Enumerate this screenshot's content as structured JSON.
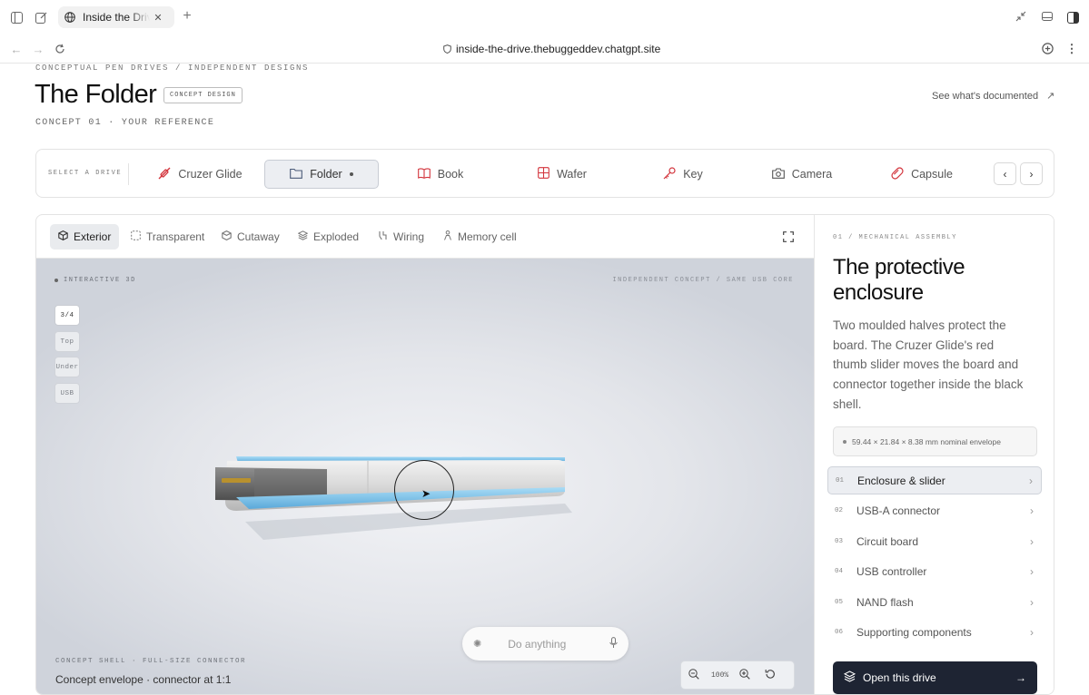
{
  "browser": {
    "tab_title": "Inside the Drive",
    "url": "inside-the-drive.thebuggeddev.chatgpt.site"
  },
  "header": {
    "breadcrumb": "CONCEPTUAL PEN DRIVES / INDEPENDENT DESIGNS",
    "title": "The Folder",
    "badge": "CONCEPT DESIGN",
    "subtitle": "CONCEPT 01 · YOUR REFERENCE",
    "docs_link": "See what's documented"
  },
  "selector": {
    "label": "SELECT A DRIVE",
    "drives": [
      {
        "label": "Cruzer Glide",
        "icon": "slider-icon"
      },
      {
        "label": "Folder",
        "icon": "folder-icon",
        "active": true
      },
      {
        "label": "Book",
        "icon": "book-icon"
      },
      {
        "label": "Wafer",
        "icon": "grid-icon"
      },
      {
        "label": "Key",
        "icon": "key-icon"
      },
      {
        "label": "Camera",
        "icon": "camera-icon"
      },
      {
        "label": "Capsule",
        "icon": "capsule-icon"
      }
    ]
  },
  "viewer": {
    "tabs": [
      {
        "label": "Exterior",
        "active": true
      },
      {
        "label": "Transparent"
      },
      {
        "label": "Cutaway"
      },
      {
        "label": "Exploded"
      },
      {
        "label": "Wiring"
      },
      {
        "label": "Memory cell"
      }
    ],
    "stage_label": "INTERACTIVE 3D",
    "stage_note": "INDEPENDENT CONCEPT / SAME USB CORE",
    "views": [
      "3/4",
      "Top",
      "Under",
      "USB"
    ],
    "prompt_placeholder": "Do anything",
    "caption_kicker": "CONCEPT SHELL · FULL-SIZE CONNECTOR",
    "caption": "Concept envelope · connector at 1:1",
    "zoom": "100%"
  },
  "panel": {
    "kicker": "01 / MECHANICAL ASSEMBLY",
    "title": "The protective enclosure",
    "description": "Two moulded halves protect the board. The Cruzer Glide's red thumb slider moves the board and connector together inside the black shell.",
    "dimensions": "59.44 × 21.84 × 8.38 mm nominal envelope",
    "items": [
      {
        "num": "01",
        "label": "Enclosure & slider",
        "active": true
      },
      {
        "num": "02",
        "label": "USB-A connector"
      },
      {
        "num": "03",
        "label": "Circuit board"
      },
      {
        "num": "04",
        "label": "USB controller"
      },
      {
        "num": "05",
        "label": "NAND flash"
      },
      {
        "num": "06",
        "label": "Supporting components"
      }
    ],
    "open_button": "Open this drive"
  },
  "colors": {
    "accent_red": "#d3343c",
    "shell_blue": "#7fc2ea",
    "dark_button": "#1e2433"
  }
}
